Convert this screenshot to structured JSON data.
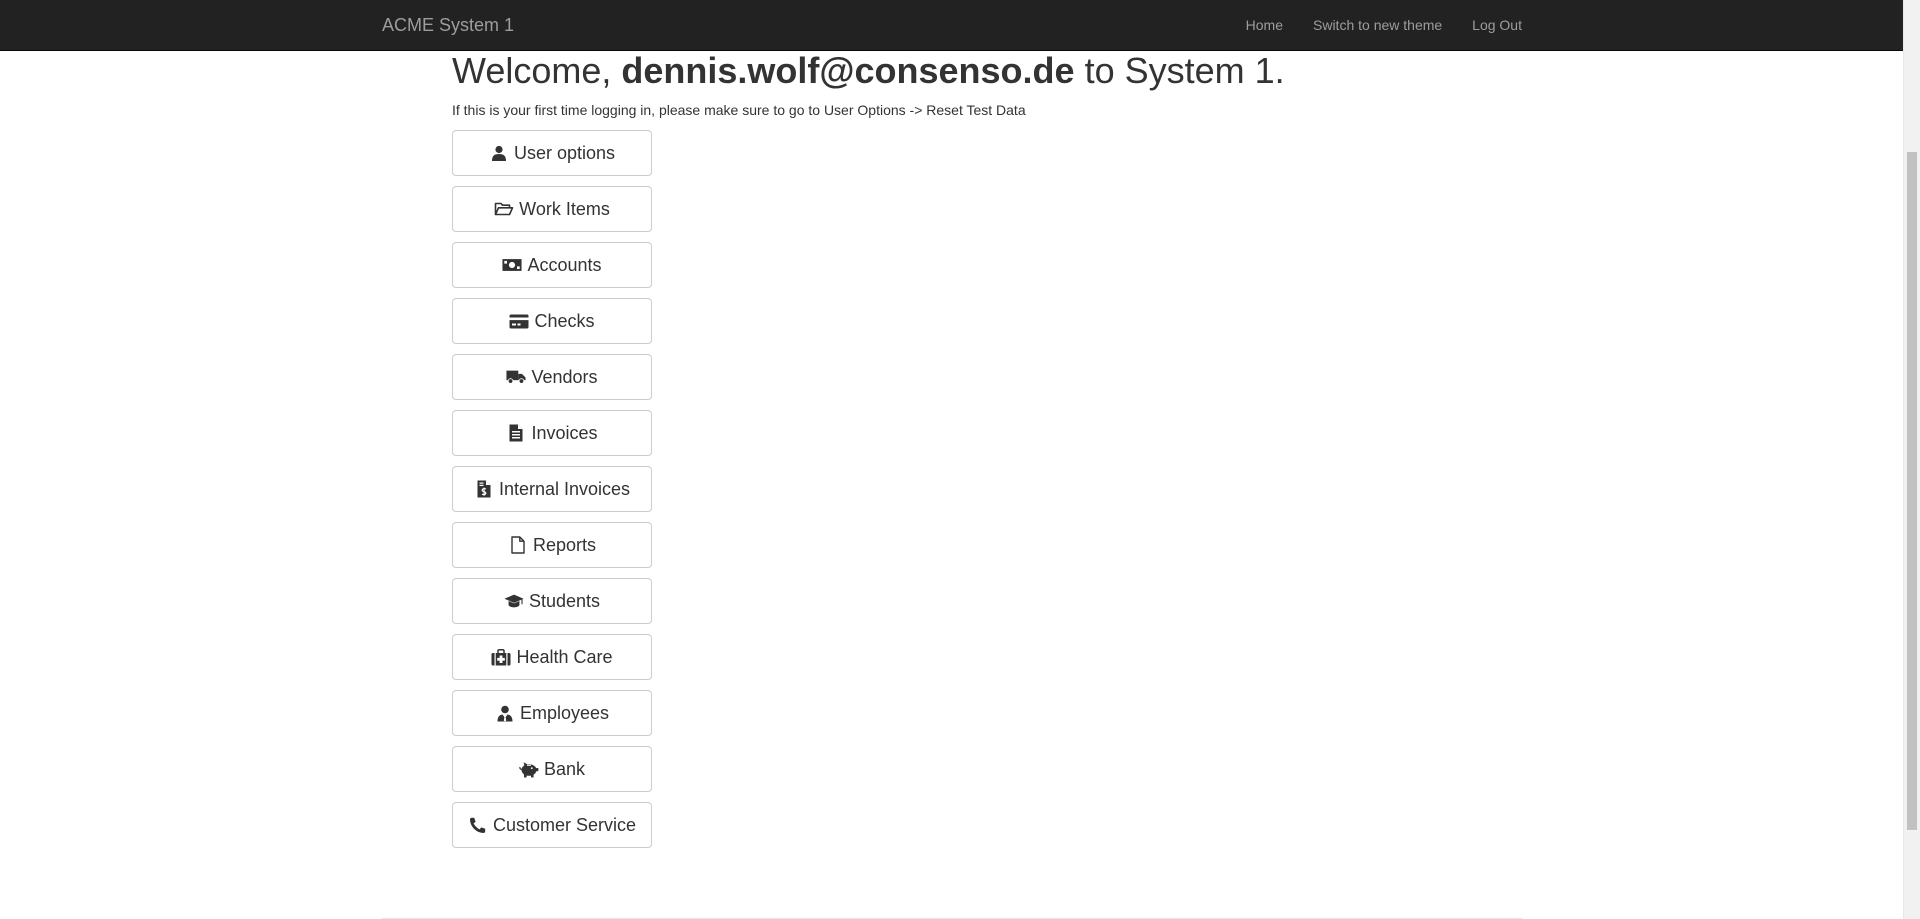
{
  "navbar": {
    "brand": "ACME System 1",
    "links": [
      {
        "label": "Home"
      },
      {
        "label": "Switch to new theme"
      },
      {
        "label": "Log Out"
      }
    ]
  },
  "welcome": {
    "prefix": "Welcome, ",
    "user": "dennis.wolf@consenso.de",
    "suffix": " to System 1."
  },
  "hint": "If this is your first time logging in, please make sure to go to User Options -> Reset Test Data",
  "menu": [
    {
      "label": "User options",
      "icon": "user-icon"
    },
    {
      "label": "Work Items",
      "icon": "folder-open-icon"
    },
    {
      "label": "Accounts",
      "icon": "money-bill-icon"
    },
    {
      "label": "Checks",
      "icon": "credit-card-icon"
    },
    {
      "label": "Vendors",
      "icon": "truck-icon"
    },
    {
      "label": "Invoices",
      "icon": "file-text-icon"
    },
    {
      "label": "Internal Invoices",
      "icon": "file-invoice-dollar-icon"
    },
    {
      "label": "Reports",
      "icon": "file-icon"
    },
    {
      "label": "Students",
      "icon": "graduation-cap-icon"
    },
    {
      "label": "Health Care",
      "icon": "medkit-icon"
    },
    {
      "label": "Employees",
      "icon": "user-tie-icon"
    },
    {
      "label": "Bank",
      "icon": "piggy-bank-icon"
    },
    {
      "label": "Customer Service",
      "icon": "phone-icon"
    }
  ]
}
